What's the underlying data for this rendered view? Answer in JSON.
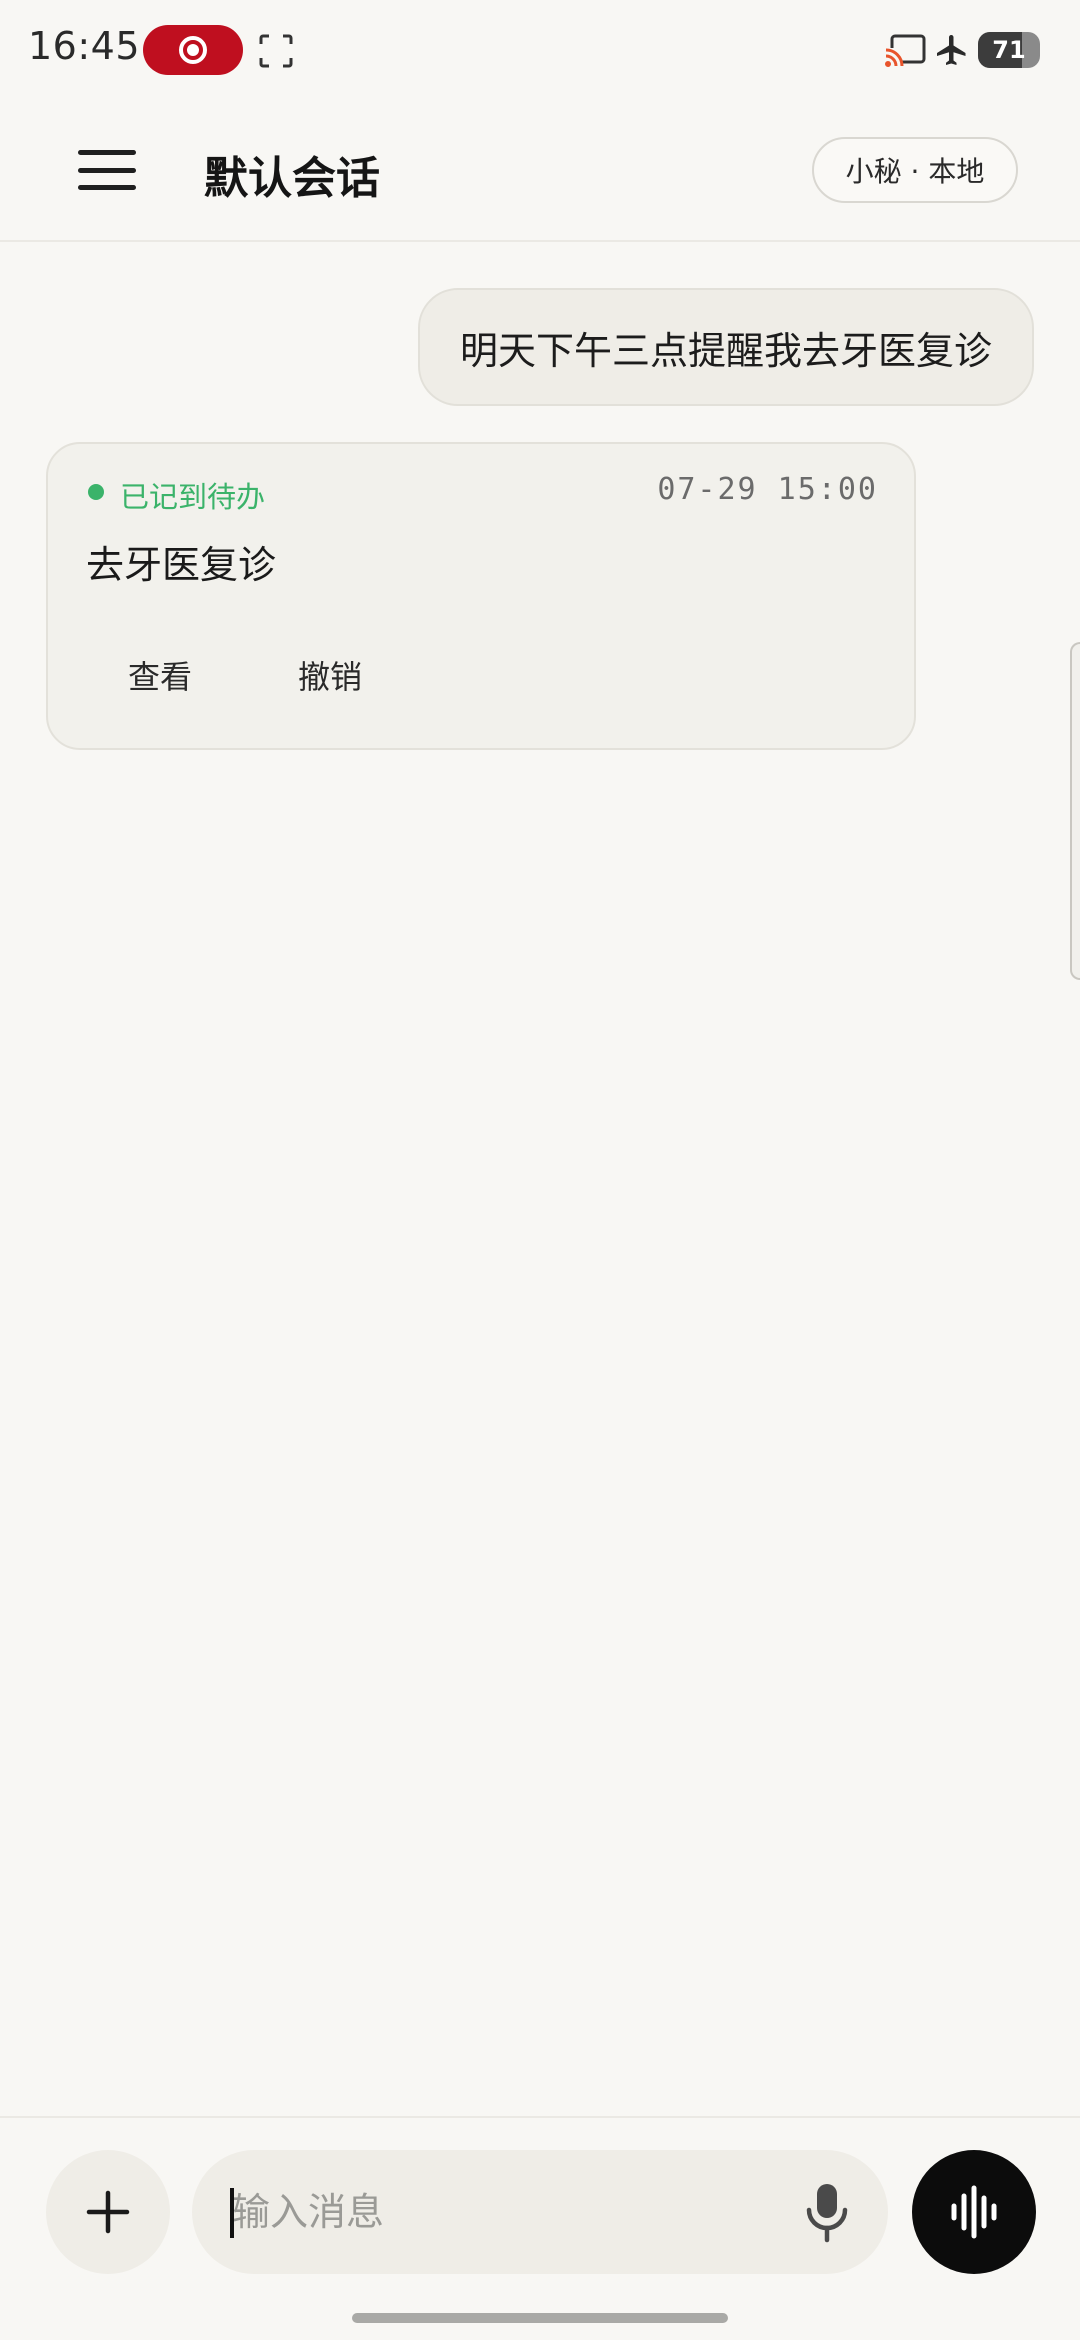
{
  "status_bar": {
    "time": "16:45",
    "battery": "71",
    "icons": [
      "screen-record-icon",
      "screenshot-icon",
      "cast-icon",
      "airplane-icon"
    ]
  },
  "header": {
    "title": "默认会话",
    "model_chip": "小秘 · 本地"
  },
  "chat": {
    "user_message": "明天下午三点提醒我去牙医复诊",
    "todo_card": {
      "status": "已记到待办",
      "datetime": "07-29  15:00",
      "title": "去牙医复诊",
      "view_label": "查看",
      "undo_label": "撤销"
    }
  },
  "input": {
    "placeholder": "输入消息",
    "value": ""
  },
  "colors": {
    "background": "#f8f7f4",
    "accent_green": "#3bb36a",
    "record_red": "#bf0f1f",
    "voice_button": "#0c0c0c"
  }
}
